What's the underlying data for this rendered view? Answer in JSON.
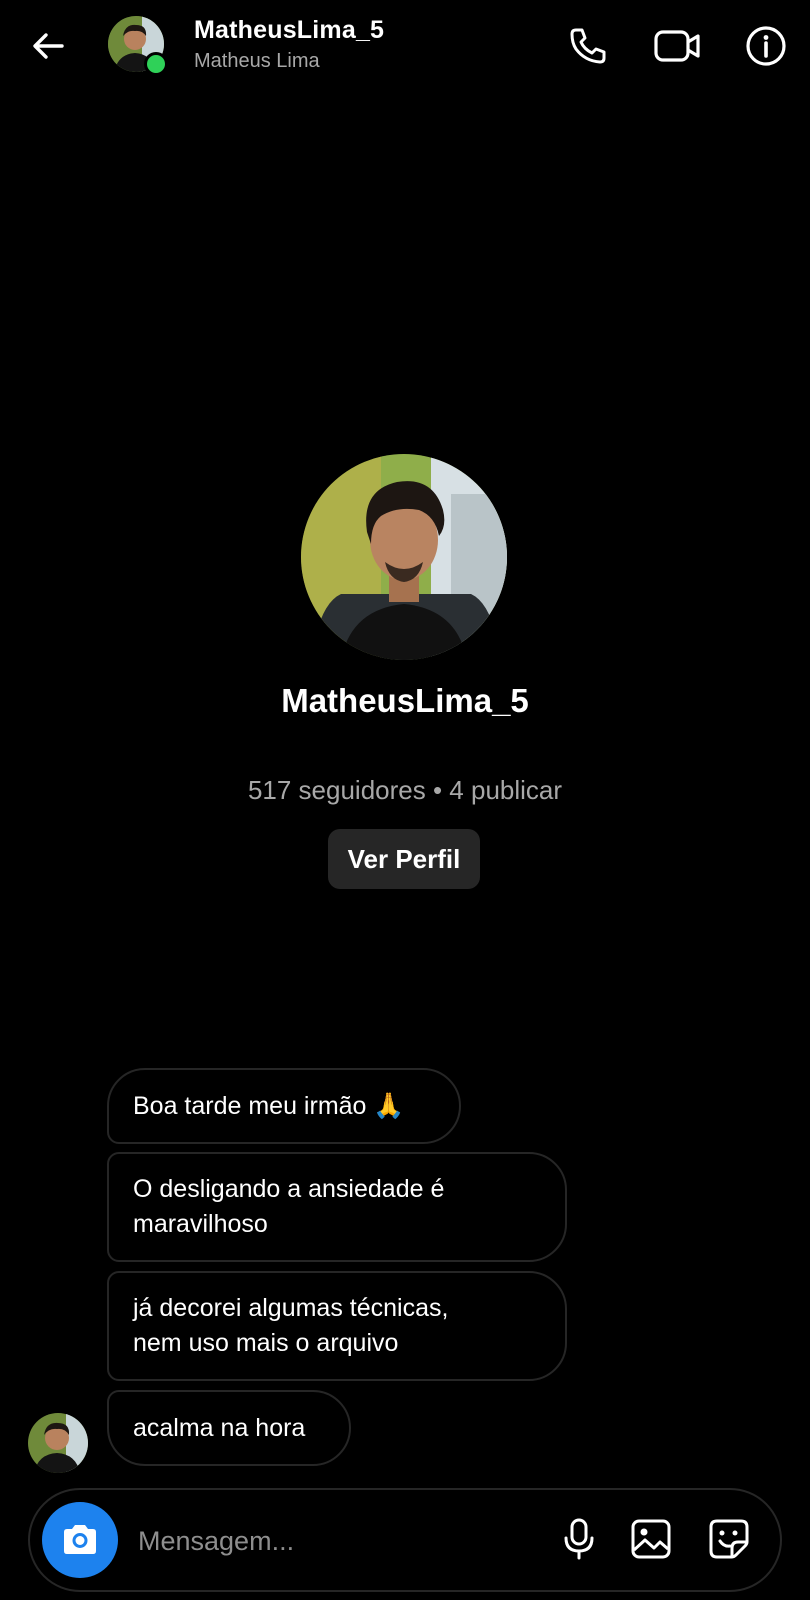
{
  "header": {
    "username": "MatheusLima_5",
    "display_name": "Matheus Lima",
    "status": "online"
  },
  "profile": {
    "username": "MatheusLima_5",
    "stats": "517 seguidores • 4 publicar",
    "view_profile_label": "Ver Perfil"
  },
  "messages": [
    {
      "text": "Boa tarde meu irmão 🙏"
    },
    {
      "text": "O desligando a ansiedade é\nmaravilhoso"
    },
    {
      "text": "já decorei algumas técnicas,\nnem uso mais o arquivo"
    },
    {
      "text": "acalma na hora"
    }
  ],
  "composer": {
    "placeholder": "Mensagem..."
  },
  "icons": {
    "back": "arrow-left-icon",
    "call": "phone-icon",
    "video": "video-camera-icon",
    "info": "info-icon",
    "camera": "camera-icon",
    "mic": "microphone-icon",
    "gallery": "image-icon",
    "sticker": "sticker-icon"
  },
  "colors": {
    "background": "#000000",
    "online": "#2fd158",
    "camera_button": "#1d82ee",
    "bubble_border": "#262626",
    "muted_text": "#a8a8a8"
  }
}
